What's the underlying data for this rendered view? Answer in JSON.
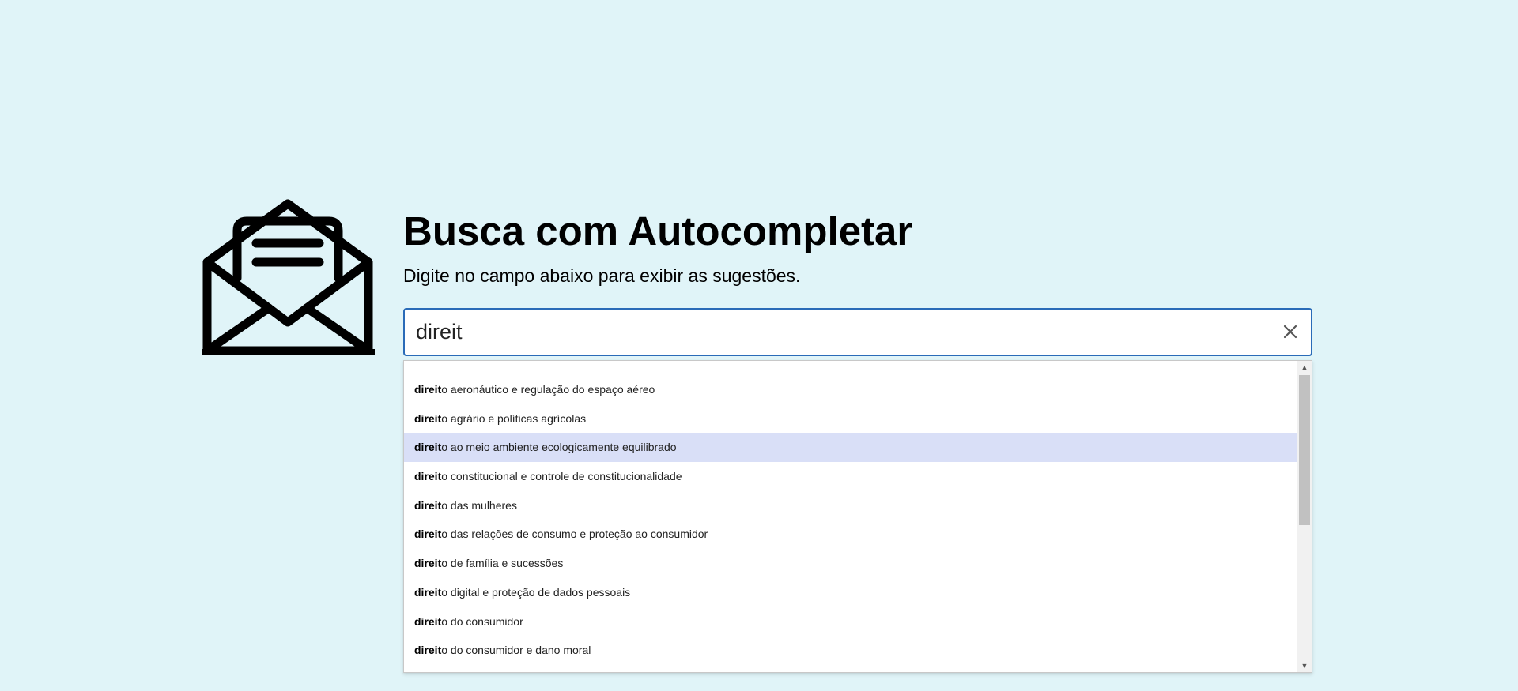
{
  "header": {
    "title": "Busca com Autocompletar",
    "subtitle": "Digite no campo abaixo para exibir as sugestões."
  },
  "logo": {
    "icon": "open-envelope-icon"
  },
  "search": {
    "value": "direit",
    "clear_icon": "close-icon"
  },
  "suggestions": {
    "match": "direit",
    "active_index": 2,
    "items": [
      {
        "match": "direit",
        "rest": "o aeronáutico e regulação do espaço aéreo"
      },
      {
        "match": "direit",
        "rest": "o agrário e políticas agrícolas"
      },
      {
        "match": "direit",
        "rest": "o ao meio ambiente ecologicamente equilibrado"
      },
      {
        "match": "direit",
        "rest": "o constitucional e controle de constitucionalidade"
      },
      {
        "match": "direit",
        "rest": "o das mulheres"
      },
      {
        "match": "direit",
        "rest": "o das relações de consumo e proteção ao consumidor"
      },
      {
        "match": "direit",
        "rest": "o de família e sucessões"
      },
      {
        "match": "direit",
        "rest": "o digital e proteção de dados pessoais"
      },
      {
        "match": "direit",
        "rest": "o do consumidor"
      },
      {
        "match": "direit",
        "rest": "o do consumidor e dano moral"
      }
    ]
  },
  "colors": {
    "background": "#e0f4f8",
    "input_border": "#2a6bb8",
    "active_item": "#d9dff7"
  }
}
